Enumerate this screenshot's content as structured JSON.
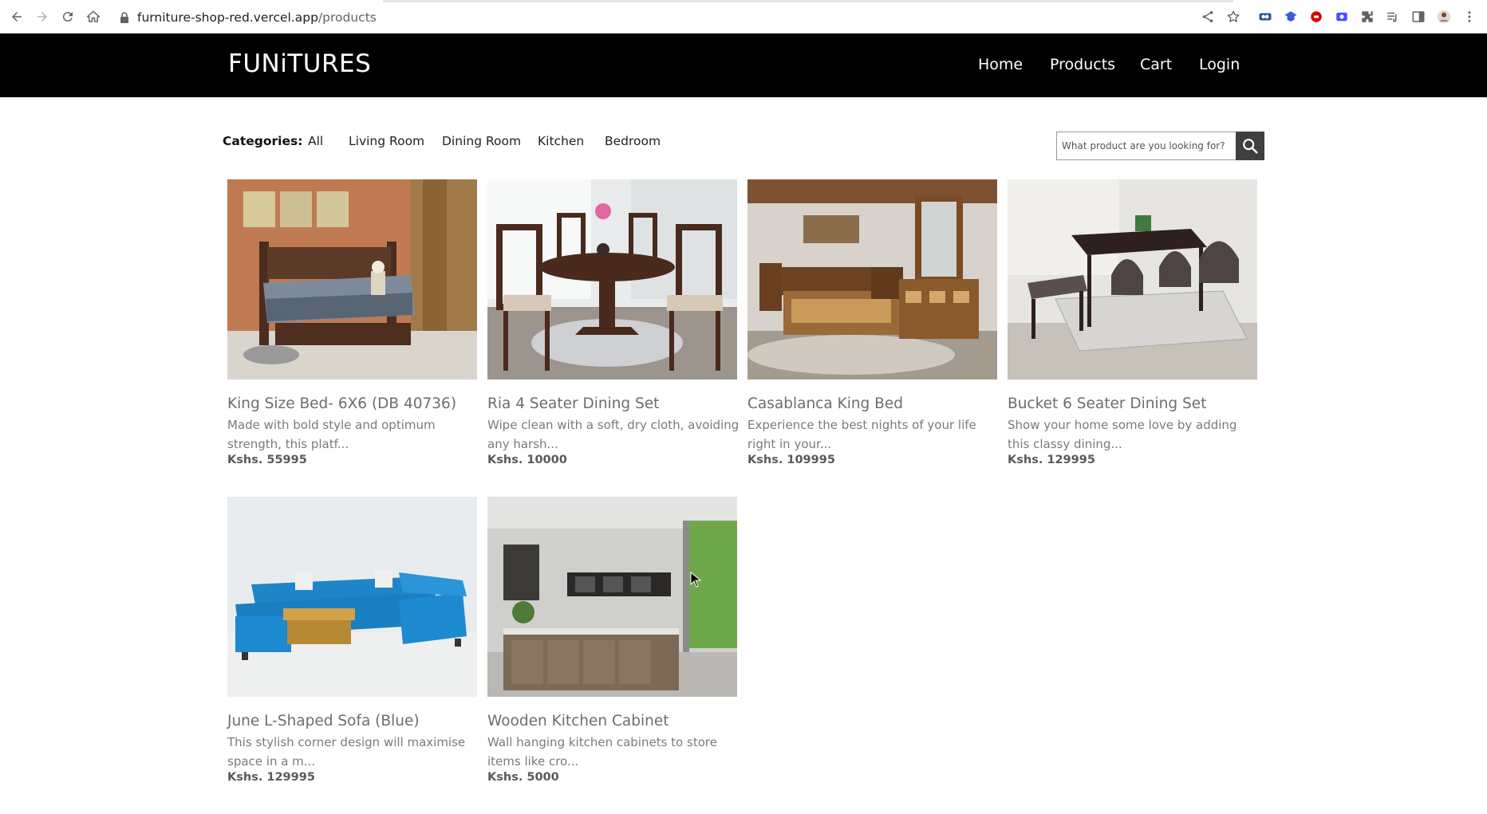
{
  "browser": {
    "url_host": "furniture-shop-red.vercel.app",
    "url_path": "/products",
    "icons": [
      "back-icon",
      "forward-icon",
      "reload-icon",
      "home-icon",
      "lock-icon",
      "share-icon",
      "star-icon",
      "extension-icons",
      "profile-avatar",
      "menu-icon"
    ]
  },
  "header": {
    "brand": "FUNiTURES",
    "nav": [
      "Home",
      "Products",
      "Cart",
      "Login"
    ]
  },
  "filters": {
    "label": "Categories:",
    "items": [
      "All",
      "Living Room",
      "Dining Room",
      "Kitchen",
      "Bedroom"
    ]
  },
  "search": {
    "placeholder": "What product are you looking for?"
  },
  "products": [
    {
      "name": "King Size Bed- 6X6 (DB 40736)",
      "desc": "Made with bold style and optimum strength, this platf...",
      "price": "Kshs. 55995"
    },
    {
      "name": "Ria 4 Seater Dining Set",
      "desc": "Wipe clean with a soft, dry cloth, avoiding any harsh...",
      "price": "Kshs. 10000"
    },
    {
      "name": "Casablanca King Bed",
      "desc": "Experience the best nights of your life right in your...",
      "price": "Kshs. 109995"
    },
    {
      "name": "Bucket 6 Seater Dining Set",
      "desc": "Show your home some love by adding this classy dining...",
      "price": "Kshs. 129995"
    },
    {
      "name": "June L-Shaped Sofa (Blue)",
      "desc": "This stylish corner design will maximise space in a m...",
      "price": "Kshs. 129995"
    },
    {
      "name": "Wooden Kitchen Cabinet",
      "desc": "Wall hanging kitchen cabinets to store items like cro...",
      "price": "Kshs. 5000"
    }
  ],
  "colors": {
    "header_bg": "#000000",
    "header_text": "#ffffff",
    "title_text": "#6d6d6d",
    "search_button": "#3f3f3f"
  }
}
